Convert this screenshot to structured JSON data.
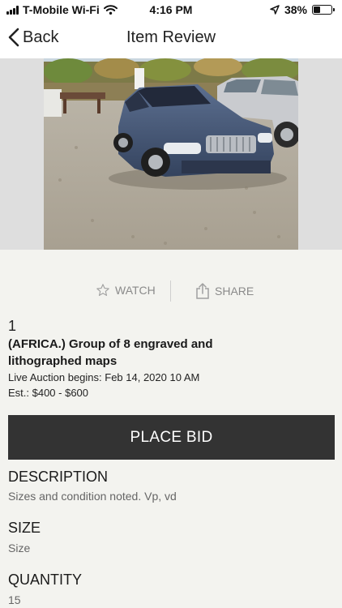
{
  "status_bar": {
    "carrier": "T-Mobile Wi-Fi",
    "time": "4:16 PM",
    "battery": "38%",
    "battery_level": 0.38
  },
  "nav": {
    "back_label": "Back",
    "title": "Item Review"
  },
  "actions": {
    "watch_label": "WATCH",
    "share_label": "SHARE"
  },
  "lot": {
    "number": "1",
    "title": "(AFRICA.) Group of 8 engraved and lithographed maps",
    "auction_line": "Live Auction begins: Feb 14, 2020 10 AM",
    "estimate_line": "Est.: $400 - $600"
  },
  "bid_button_label": "PLACE BID",
  "sections": {
    "description": {
      "heading": "DESCRIPTION",
      "body": "Sizes and condition noted. Vp, vd"
    },
    "size": {
      "heading": "SIZE",
      "body": "Size"
    },
    "quantity": {
      "heading": "QUANTITY",
      "body": "15"
    }
  },
  "colors": {
    "accent_button": "#333333",
    "page_background": "#f3f3ef",
    "muted_text": "#8a8a8a"
  }
}
